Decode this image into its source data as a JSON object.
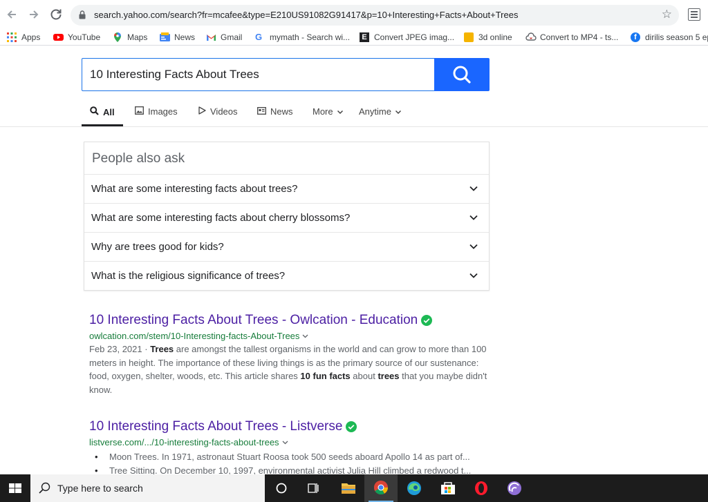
{
  "browser": {
    "url": "search.yahoo.com/search?fr=mcafee&type=E210US91082G91417&p=10+Interesting+Facts+About+Trees",
    "bookmarks": [
      {
        "label": "Apps",
        "icon": "apps-grid-icon"
      },
      {
        "label": "YouTube",
        "icon": "youtube-icon"
      },
      {
        "label": "Maps",
        "icon": "maps-pin-icon"
      },
      {
        "label": "News",
        "icon": "news-icon"
      },
      {
        "label": "Gmail",
        "icon": "gmail-icon"
      },
      {
        "label": "mymath - Search wi...",
        "icon": "google-icon"
      },
      {
        "label": "Convert JPEG imag...",
        "icon": "e-logo-icon"
      },
      {
        "label": "3d online",
        "icon": "3d-online-icon"
      },
      {
        "label": "Convert to MP4 - ts...",
        "icon": "cloud-icon"
      },
      {
        "label": "dirilis season 5 ep",
        "icon": "facebook-icon"
      }
    ]
  },
  "search": {
    "query": "10 Interesting Facts About Trees"
  },
  "tabs": [
    {
      "label": "All",
      "icon": "search-icon",
      "active": true
    },
    {
      "label": "Images",
      "icon": "image-icon"
    },
    {
      "label": "Videos",
      "icon": "play-icon"
    },
    {
      "label": "News",
      "icon": "newspaper-icon"
    },
    {
      "label": "More",
      "icon": "chevron-down-icon"
    },
    {
      "label": "Anytime",
      "icon": "chevron-down-icon"
    }
  ],
  "people_also_ask": {
    "title": "People also ask",
    "questions": [
      "What are some interesting facts about trees?",
      "What are some interesting facts about cherry blossoms?",
      "Why are trees good for kids?",
      "What is the religious significance of trees?"
    ]
  },
  "results": [
    {
      "title": "10 Interesting Facts About Trees - Owlcation - Education",
      "url": "owlcation.com/stem/10-Interesting-facts-About-Trees",
      "date": "Feb 23, 2021",
      "sep": " · ",
      "snippet": {
        "s1": "Trees",
        "s2": " are amongst the tallest organisms in the world and can grow to more than 100 meters in height. The importance of these living things is as the primary source of our sustenance: food, oxygen, shelter, woods, etc. This article shares ",
        "s3": "10 fun facts",
        "s4": " about ",
        "s5": "trees",
        "s6": " that you maybe didn't know."
      }
    },
    {
      "title": "10 Interesting Facts About Trees - Listverse",
      "url": "listverse.com/.../10-interesting-facts-about-trees",
      "bullets": [
        "Moon Trees. In 1971, astronaut Stuart Roosa took 500 seeds aboard Apollo 14 as part of...",
        "Tree Sitting. On December 10, 1997, environmental activist Julia Hill climbed a redwood t..."
      ]
    }
  ],
  "taskbar": {
    "search_placeholder": "Type here to search"
  },
  "colors": {
    "accent": "#1a66ff",
    "link": "#4b1ea3",
    "url_green": "#167c3a",
    "verified": "#1db954"
  }
}
